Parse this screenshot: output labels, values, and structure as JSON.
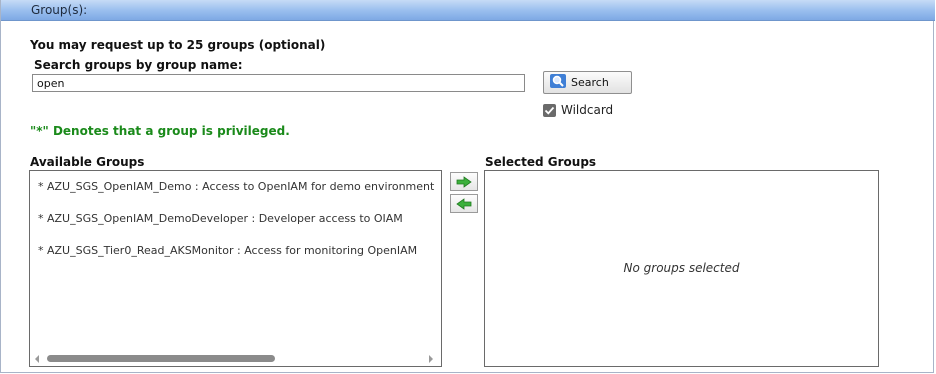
{
  "header": {
    "title": "Group(s):"
  },
  "intro": {
    "limit_text": "You may request up to 25 groups (optional)"
  },
  "search": {
    "label": "Search groups by group name:",
    "value": "open",
    "button_label": "Search",
    "wildcard_label": "Wildcard",
    "wildcard_checked": true
  },
  "notes": {
    "privileged": "\"*\" Denotes that a group is privileged."
  },
  "available": {
    "title": "Available Groups",
    "items": [
      "* AZU_SGS_OpenIAM_Demo : Access to OpenIAM for demo environment",
      "* AZU_SGS_OpenIAM_DemoDeveloper : Developer access to OIAM",
      "* AZU_SGS_Tier0_Read_AKSMonitor : Access for monitoring OpenIAM"
    ]
  },
  "selected": {
    "title": "Selected Groups",
    "empty_text": "No groups selected"
  },
  "colors": {
    "note_green": "#1a8a1a",
    "header_blue": "#98bdee",
    "arrow_green": "#2fa02f"
  }
}
